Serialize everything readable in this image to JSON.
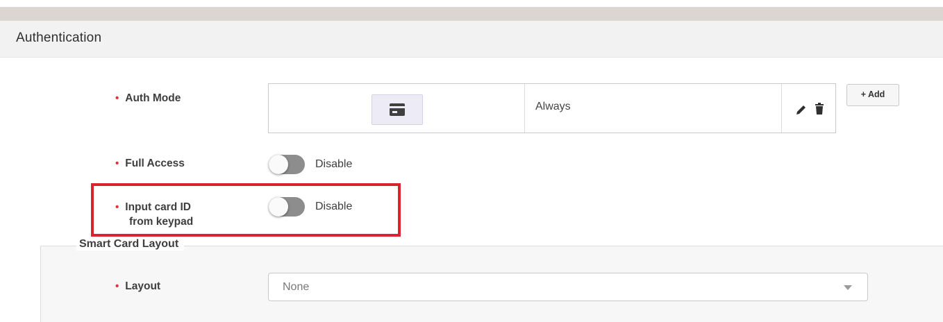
{
  "section": {
    "title": "Authentication"
  },
  "auth_mode": {
    "label": "Auth Mode",
    "icon": "card-icon",
    "schedule": "Always",
    "add_label": "+ Add"
  },
  "full_access": {
    "label": "Full Access",
    "state": "Disable"
  },
  "input_card_id": {
    "label_line1": "Input card ID",
    "label_line2": "from keypad",
    "state": "Disable"
  },
  "smart_card": {
    "legend": "Smart Card Layout",
    "layout_label": "Layout",
    "layout_value": "None"
  },
  "required_marker": "•",
  "colors": {
    "required": "#e0323a",
    "highlight": "#d9232f",
    "toggle_off": "#8d8d8d"
  }
}
